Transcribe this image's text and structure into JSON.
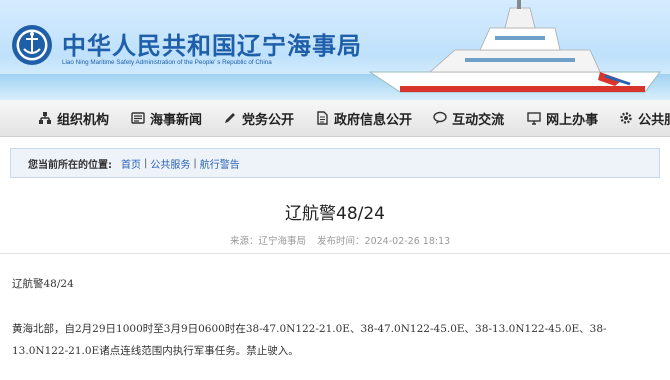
{
  "header": {
    "title": "中华人民共和国辽宁海事局",
    "subtitle": "Liao Ning Maritime Safety Administration of the People' s Republic of China",
    "logo_text": "CHINA MSA"
  },
  "nav": {
    "items": [
      {
        "label": "组织机构",
        "icon": "org-chart-icon"
      },
      {
        "label": "海事新闻",
        "icon": "newspaper-icon"
      },
      {
        "label": "党务公开",
        "icon": "pen-icon"
      },
      {
        "label": "政府信息公开",
        "icon": "document-icon"
      },
      {
        "label": "互动交流",
        "icon": "chat-icon"
      },
      {
        "label": "网上办事",
        "icon": "monitor-icon"
      },
      {
        "label": "公共服务",
        "icon": "gear-icon"
      }
    ]
  },
  "breadcrumb": {
    "label": "您当前所在的位置:",
    "items": [
      "首页",
      "公共服务",
      "航行警告"
    ]
  },
  "article": {
    "title": "辽航警48/24",
    "source": "来源：辽宁海事局",
    "published": "发布时间：2024-02-26 18:13",
    "p1": "辽航警48/24",
    "p2": "黄海北部，自2月29日1000时至3月9日0600时在38-47.0N122-21.0E、38-47.0N122-45.0E、38-13.0N122-45.0E、38-13.0N122-21.0E诸点连线范围内执行军事任务。禁止驶入。"
  },
  "colors": {
    "brand_blue": "#1f5faa",
    "link_blue": "#2a62b5",
    "nav_bg": "#ececec"
  }
}
